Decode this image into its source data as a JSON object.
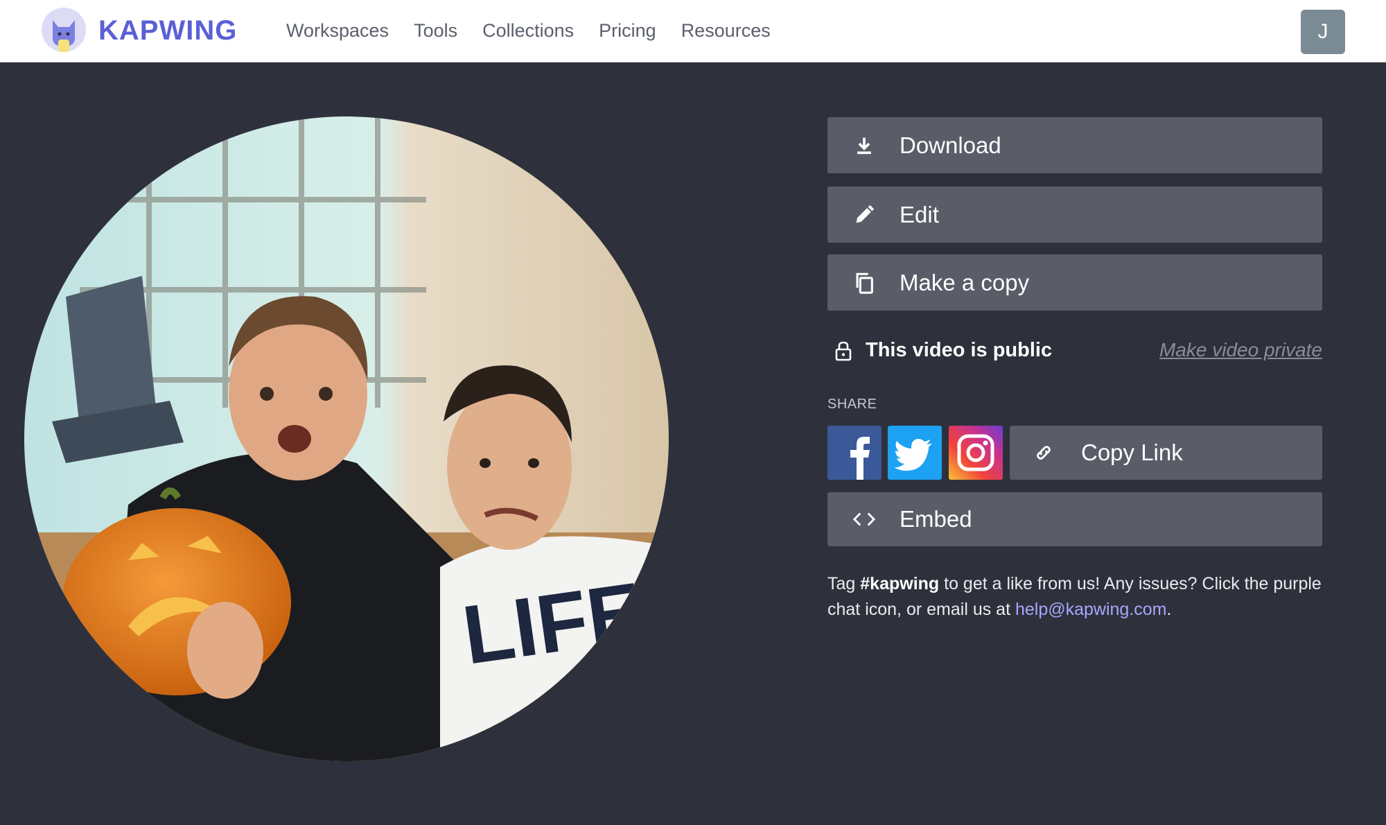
{
  "header": {
    "brand": "KAPWING",
    "nav": [
      "Workspaces",
      "Tools",
      "Collections",
      "Pricing",
      "Resources"
    ],
    "avatar_initial": "J"
  },
  "actions": {
    "download": "Download",
    "edit": "Edit",
    "copy": "Make a copy"
  },
  "visibility": {
    "status": "This video is public",
    "toggle": "Make video private"
  },
  "share": {
    "label": "SHARE",
    "copy_link": "Copy Link",
    "embed": "Embed"
  },
  "note": {
    "prefix": "Tag ",
    "hashtag": "#kapwing",
    "middle": " to get a like from us! Any issues? Click the purple chat icon, or email us at ",
    "email": "help@kapwing.com",
    "suffix": "."
  },
  "colors": {
    "background": "#2e313b",
    "button": "#5a5c68",
    "brand": "#5b5fd6",
    "facebook": "#3b5998",
    "twitter": "#1da1f2",
    "link": "#a9a6ff"
  }
}
